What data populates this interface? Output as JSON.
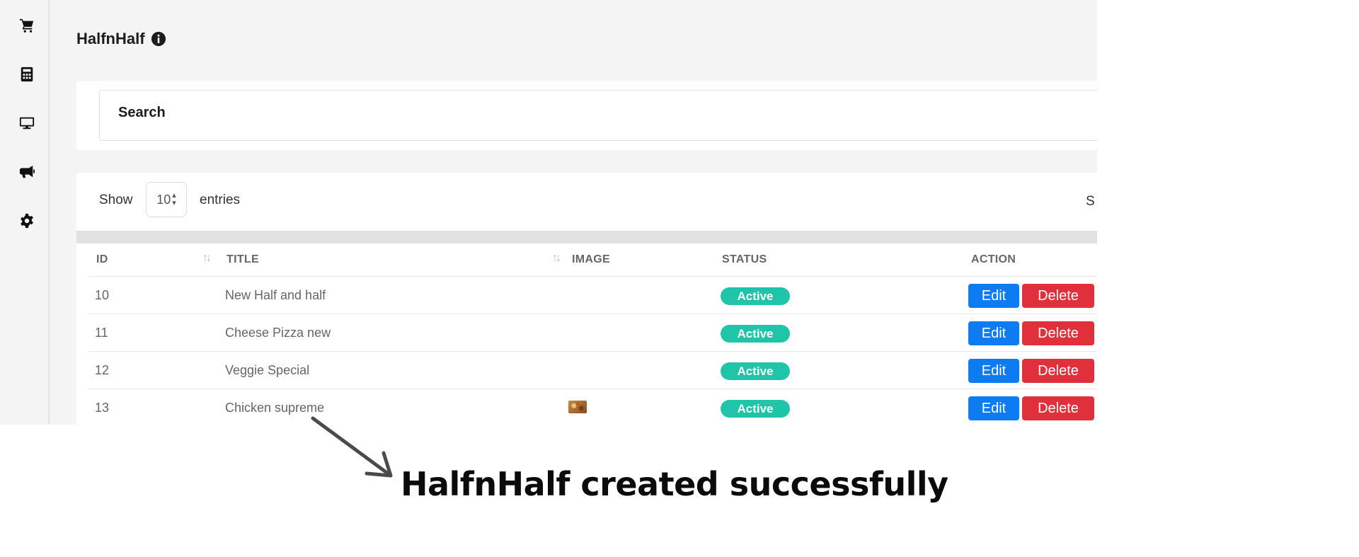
{
  "sidebar": {
    "items": [
      {
        "icon": "cart-icon"
      },
      {
        "icon": "calculator-icon"
      },
      {
        "icon": "monitor-icon"
      },
      {
        "icon": "megaphone-icon"
      },
      {
        "icon": "gear-icon"
      }
    ]
  },
  "page": {
    "title": "HalfnHalf",
    "title_icon": "info-icon"
  },
  "search_panel": {
    "label": "Search"
  },
  "table_controls": {
    "show_label": "Show",
    "entries_value": "10",
    "entries_label": "entries",
    "search_label_partial": "S"
  },
  "table": {
    "columns": [
      "ID",
      "TITLE",
      "IMAGE",
      "STATUS",
      "ACTION"
    ],
    "rows": [
      {
        "id": "10",
        "title": "New Half and half",
        "image": null,
        "status": "Active",
        "edit_label": "Edit",
        "delete_label": "Delete"
      },
      {
        "id": "11",
        "title": "Cheese Pizza new",
        "image": null,
        "status": "Active",
        "edit_label": "Edit",
        "delete_label": "Delete"
      },
      {
        "id": "12",
        "title": "Veggie Special",
        "image": null,
        "status": "Active",
        "edit_label": "Edit",
        "delete_label": "Delete"
      },
      {
        "id": "13",
        "title": "Chicken supreme",
        "image": "pizza-thumbnail",
        "status": "Active",
        "edit_label": "Edit",
        "delete_label": "Delete"
      }
    ]
  },
  "annotation": {
    "text": "HalfnHalf created successfully"
  },
  "colors": {
    "status_active": "#20c4a8",
    "edit_button": "#0d7bf2",
    "delete_button": "#e0303c"
  }
}
